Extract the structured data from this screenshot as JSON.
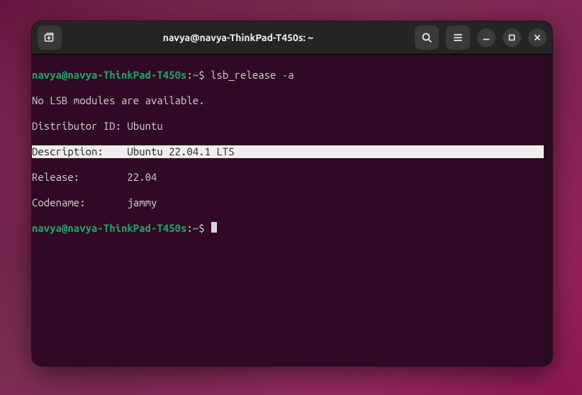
{
  "titlebar": {
    "title": "navya@navya-ThinkPad-T450s: ~"
  },
  "prompt1": {
    "user_host": "navya@navya-ThinkPad-T450s",
    "path": "~",
    "command": "lsb_release -a"
  },
  "output": {
    "line1": "No LSB modules are available.",
    "line2": "Distributor ID: Ubuntu",
    "line3": "Description:    Ubuntu 22.04.1 LTS",
    "line4": "Release:        22.04",
    "line5": "Codename:       jammy"
  },
  "prompt2": {
    "user_host": "navya@navya-ThinkPad-T450s",
    "path": "~"
  }
}
